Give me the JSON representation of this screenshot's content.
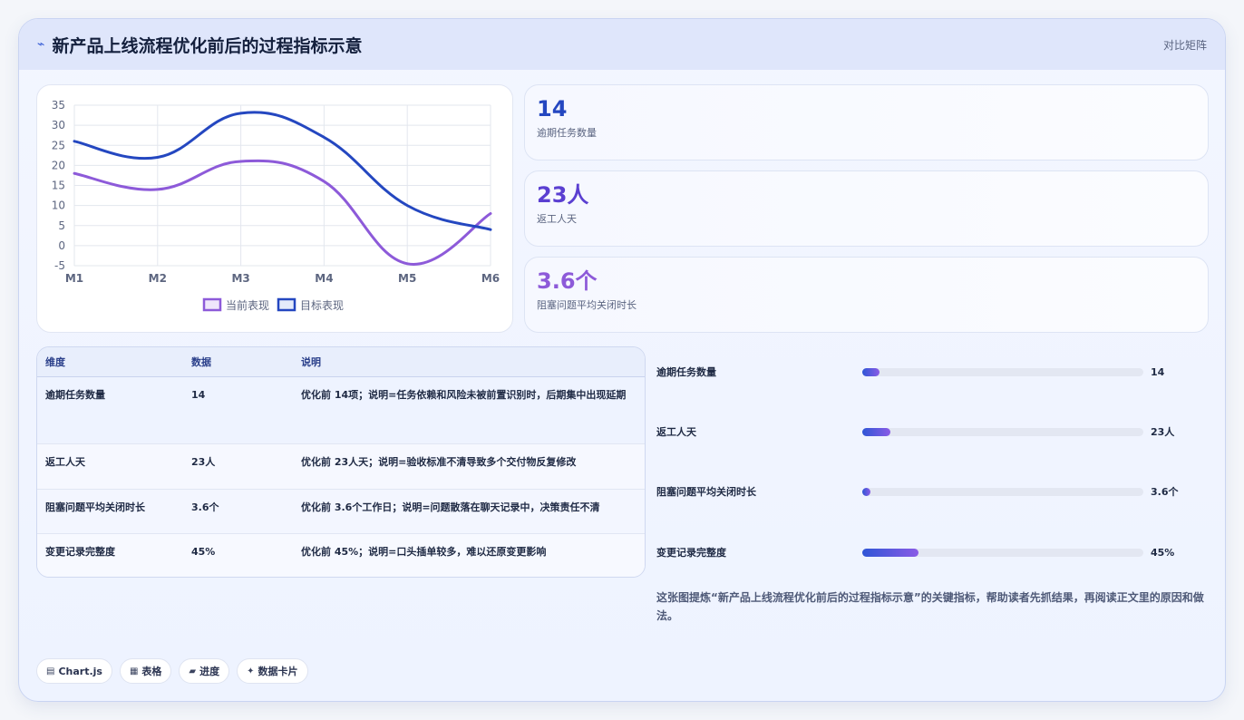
{
  "header": {
    "title": "新产品上线流程优化前后的过程指标示意",
    "tag": "对比矩阵"
  },
  "chart_data": {
    "type": "line",
    "x": [
      "M1",
      "M2",
      "M3",
      "M4",
      "M5",
      "M6"
    ],
    "ylim": [
      -5,
      35
    ],
    "yticks": [
      "35",
      "30",
      "25",
      "20",
      "15",
      "10",
      "5",
      "0",
      "-5"
    ],
    "grid": true,
    "legend_position": "bottom",
    "series": [
      {
        "name": "当前表现",
        "values": [
          18,
          14,
          21,
          16,
          -4.5,
          8
        ],
        "color": "#8d5ad9"
      },
      {
        "name": "目标表现",
        "values": [
          26,
          22,
          33,
          27,
          10,
          4
        ],
        "color": "#2447c0"
      }
    ]
  },
  "stats": [
    {
      "value": "14",
      "label": "逾期任务数量",
      "color": "#2447c0"
    },
    {
      "value": "23人",
      "label": "返工人天",
      "color": "#5a3fd1"
    },
    {
      "value": "3.6个",
      "label": "阻塞问题平均关闭时长",
      "color": "#8d5ad9"
    }
  ],
  "table": {
    "headers": [
      "维度",
      "数据",
      "说明"
    ],
    "rows": [
      {
        "dim": "逾期任务数量",
        "data": "14",
        "desc": "优化前 14项；说明=任务依赖和风险未被前置识别时，后期集中出现延期"
      },
      {
        "dim": "返工人天",
        "data": "23人",
        "desc": "优化前 23人天；说明=验收标准不清导致多个交付物反复修改"
      },
      {
        "dim": "阻塞问题平均关闭时长",
        "data": "3.6个",
        "desc": "优化前 3.6个工作日；说明=问题散落在聊天记录中，决策责任不清"
      },
      {
        "dim": "变更记录完整度",
        "data": "45%",
        "desc": "优化前 45%；说明=口头插单较多，难以还原变更影响"
      }
    ]
  },
  "progress": [
    {
      "label": "逾期任务数量",
      "value": "14",
      "fraction": 0.06
    },
    {
      "label": "返工人天",
      "value": "23人",
      "fraction": 0.1
    },
    {
      "label": "阻塞问题平均关闭时长",
      "value": "3.6个",
      "fraction": 0.03
    },
    {
      "label": "变更记录完整度",
      "value": "45%",
      "fraction": 0.2
    }
  ],
  "note": "这张图提炼“新产品上线流程优化前后的过程指标示意”的关键指标，帮助读者先抓结果，再阅读正文里的原因和做法。",
  "chips": [
    {
      "icon": "▤",
      "label": "Chart.js"
    },
    {
      "icon": "▦",
      "label": "表格"
    },
    {
      "icon": "▰",
      "label": "进度"
    },
    {
      "icon": "✦",
      "label": "数据卡片"
    }
  ]
}
